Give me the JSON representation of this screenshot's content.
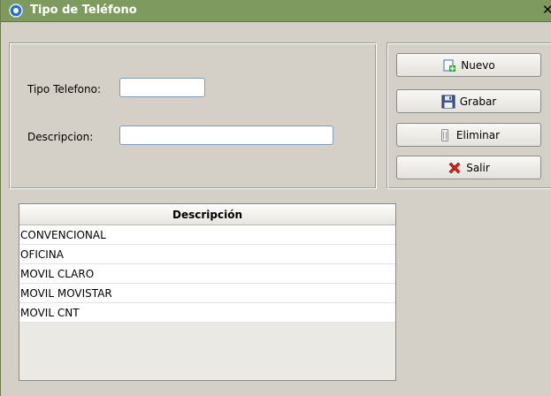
{
  "window": {
    "title": "Tipo de Teléfono",
    "close_glyph": "✕",
    "titlebar_color": "#7f9a5e"
  },
  "form": {
    "tipo_label": "Tipo Telefono:",
    "tipo_value": "",
    "descripcion_label": "Descripcion:",
    "descripcion_value": ""
  },
  "buttons": {
    "nuevo": "Nuevo",
    "grabar": "Grabar",
    "eliminar": "Eliminar",
    "salir": "Salir"
  },
  "table": {
    "header": "Descripción",
    "rows": [
      "CONVENCIONAL",
      "OFICINA",
      "MOVIL CLARO",
      "MOVIL MOVISTAR",
      "MOVIL CNT"
    ]
  },
  "icons": {
    "title": "app-logo-icon",
    "nuevo": "new-document-icon",
    "grabar": "floppy-disk-icon",
    "eliminar": "trash-can-icon",
    "salir": "red-x-icon"
  }
}
